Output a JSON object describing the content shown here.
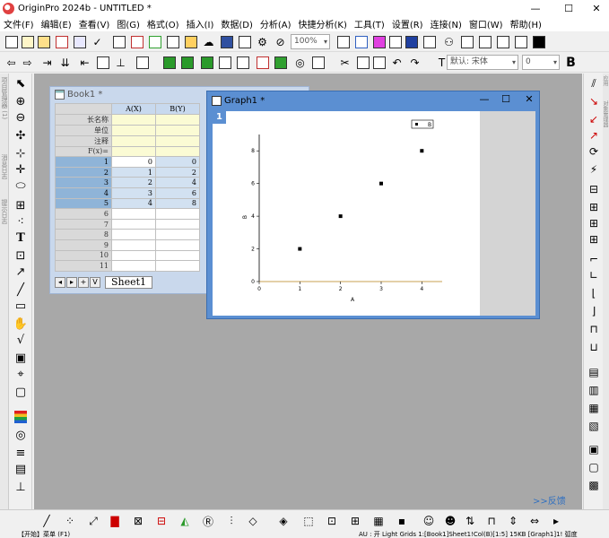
{
  "window": {
    "title": "OriginPro 2024b - UNTITLED *",
    "min": "—",
    "max": "☐",
    "close": "✕"
  },
  "menu": [
    "文件(F)",
    "编辑(E)",
    "查看(V)",
    "图(G)",
    "格式(O)",
    "插入(I)",
    "数据(D)",
    "分析(A)",
    "快捷分析(K)",
    "工具(T)",
    "设置(R)",
    "连接(N)",
    "窗口(W)",
    "帮助(H)"
  ],
  "toolbar": {
    "zoom": "100%",
    "font": "默认: 宋体",
    "size": "0",
    "bold": "B"
  },
  "book": {
    "title": "Book1 *",
    "columns": [
      "A(X)",
      "B(Y)"
    ],
    "meta_rows": [
      "长名称",
      "单位",
      "注释",
      "F(x)="
    ],
    "rows": [
      {
        "n": "1",
        "a": "0",
        "b": "0"
      },
      {
        "n": "2",
        "a": "1",
        "b": "2"
      },
      {
        "n": "3",
        "a": "2",
        "b": "4"
      },
      {
        "n": "4",
        "a": "3",
        "b": "6"
      },
      {
        "n": "5",
        "a": "4",
        "b": "8"
      },
      {
        "n": "6",
        "a": "",
        "b": ""
      },
      {
        "n": "7",
        "a": "",
        "b": ""
      },
      {
        "n": "8",
        "a": "",
        "b": ""
      },
      {
        "n": "9",
        "a": "",
        "b": ""
      },
      {
        "n": "10",
        "a": "",
        "b": ""
      },
      {
        "n": "11",
        "a": "",
        "b": ""
      }
    ],
    "sheet_tab": "Sheet1",
    "nav_plus": "+",
    "nav_down": "V"
  },
  "graph": {
    "title": "Graph1 *",
    "layer": "1",
    "min": "—",
    "max": "☐",
    "close": "✕"
  },
  "chart_data": {
    "type": "scatter",
    "x": [
      1,
      2,
      3,
      4
    ],
    "y": [
      2,
      4,
      6,
      8
    ],
    "xlabel": "A",
    "ylabel": "B",
    "xlim": [
      0,
      4.5
    ],
    "ylim": [
      0,
      9
    ],
    "xticks": [
      0,
      1,
      2,
      3,
      4
    ],
    "yticks": [
      0,
      2,
      4,
      6,
      8
    ],
    "legend": [
      "B"
    ],
    "legend_position": "top-right"
  },
  "left_strip_text": [
    "项目管理器 (1)",
    "消息日志",
    "提示日志"
  ],
  "right_strip_text": [
    "应用",
    "对象管理器"
  ],
  "feedback": ">>反馈",
  "status": {
    "left": "【开始】菜单 (F1)",
    "right": "AU : 开  Light Grids  1:[Book1]Sheet1!Col(B)[1:5]  15KB  [Graph1]1!  弧度"
  }
}
